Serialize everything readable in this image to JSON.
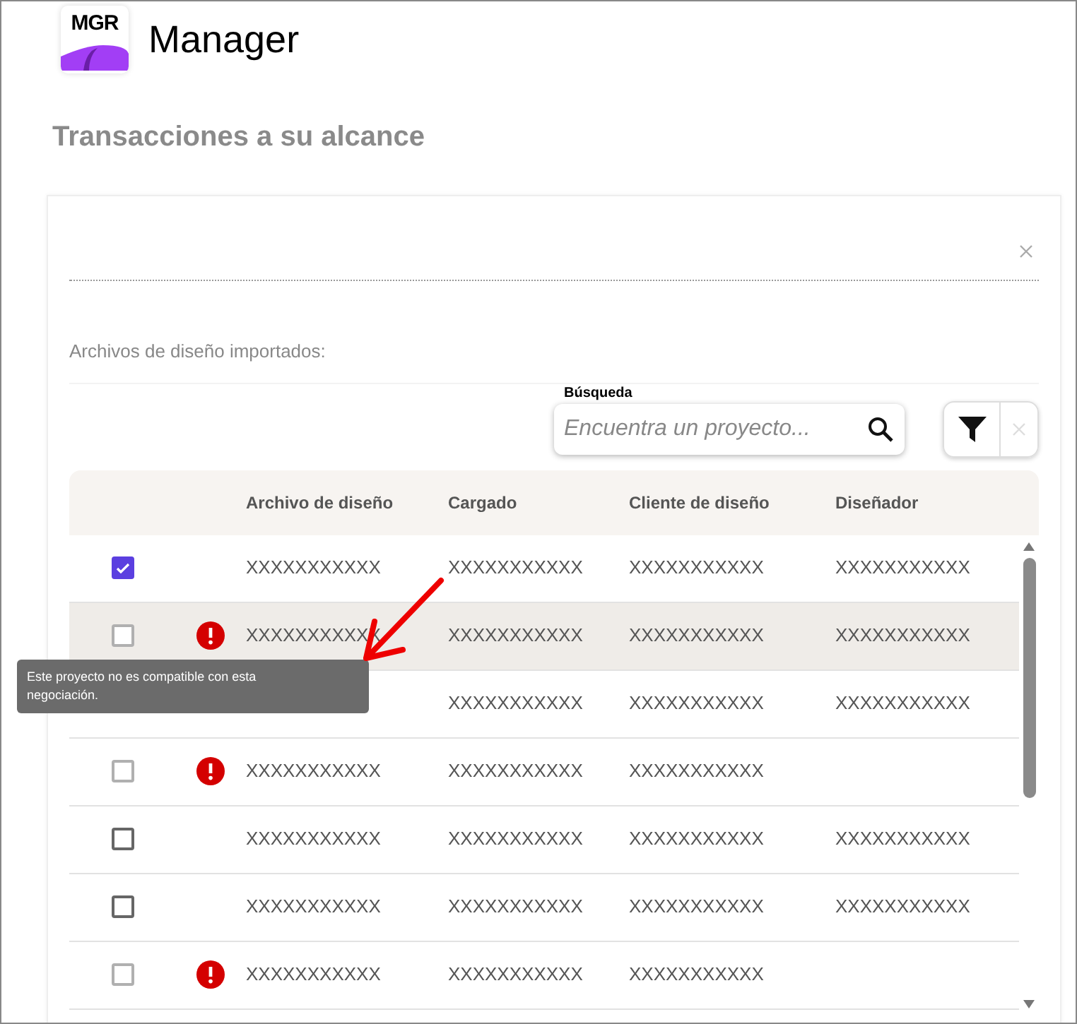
{
  "app": {
    "logo_text": "MGR",
    "name": "Manager"
  },
  "page_title": "Transacciones a su alcance",
  "section_label": "Archivos de diseño importados:",
  "search": {
    "label": "Búsqueda",
    "placeholder": "Encuentra un proyecto..."
  },
  "table": {
    "columns": [
      "Archivo de diseño",
      "Cargado",
      "Cliente de diseño",
      "Diseñador"
    ],
    "rows": [
      {
        "kind": "row",
        "checked": true,
        "disabled": false,
        "warning": false,
        "highlighted": false,
        "cells": [
          "XXXXXXXXXXX",
          "XXXXXXXXXXX",
          "XXXXXXXXXXX",
          "XXXXXXXXXXX"
        ]
      },
      {
        "kind": "row",
        "checked": false,
        "disabled": true,
        "warning": true,
        "highlighted": true,
        "cells": [
          "XXXXXXXXXXX",
          "XXXXXXXXXXX",
          "XXXXXXXXXXX",
          "XXXXXXXXXXX"
        ]
      },
      {
        "kind": "covered",
        "cells": [
          "",
          "XXXXXXXXXXX",
          "XXXXXXXXXXX",
          "XXXXXXXXXXX"
        ]
      },
      {
        "kind": "row",
        "checked": false,
        "disabled": true,
        "warning": true,
        "highlighted": false,
        "cells": [
          "XXXXXXXXXXX",
          "XXXXXXXXXXX",
          "XXXXXXXXXXX"
        ]
      },
      {
        "kind": "row",
        "checked": false,
        "disabled": false,
        "warning": false,
        "highlighted": false,
        "cells": [
          "XXXXXXXXXXX",
          "XXXXXXXXXXX",
          "XXXXXXXXXXX",
          "XXXXXXXXXXX"
        ]
      },
      {
        "kind": "row",
        "checked": false,
        "disabled": false,
        "warning": false,
        "highlighted": false,
        "cells": [
          "XXXXXXXXXXX",
          "XXXXXXXXXXX",
          "XXXXXXXXXXX",
          "XXXXXXXXXXX"
        ]
      },
      {
        "kind": "row",
        "checked": false,
        "disabled": true,
        "warning": true,
        "highlighted": false,
        "cells": [
          "XXXXXXXXXXX",
          "XXXXXXXXXXX",
          "XXXXXXXXXXX"
        ]
      }
    ]
  },
  "tooltip": "Este proyecto no es compatible con esta negociación."
}
